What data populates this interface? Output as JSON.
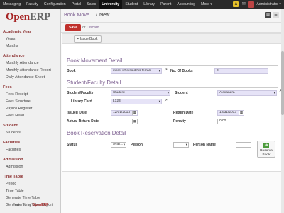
{
  "topbar": {
    "menu": [
      "Messaging",
      "Faculty",
      "Configuration",
      "Portal",
      "Sales",
      "University",
      "Student",
      "Library",
      "Parent",
      "Accounting",
      "More ▾"
    ],
    "active_index": 5,
    "badge": "A",
    "user_name": "Administrator ▾"
  },
  "sidebar": {
    "logo_main": "Open",
    "logo_brand": "ERP",
    "groups": [
      {
        "heading": "Academic Year",
        "items": [
          "Years",
          "Months"
        ]
      },
      {
        "heading": "Attendance",
        "items": [
          "Monthly Attendance",
          "Monthly Attendance Report",
          "Daily Attendance Sheet"
        ]
      },
      {
        "heading": "Fees",
        "items": [
          "Fees Receipt",
          "Fees Structure",
          "Payroll Register",
          "Fees Head"
        ]
      },
      {
        "heading": "Student",
        "items": [
          "Students"
        ]
      },
      {
        "heading": "Faculties",
        "items": [
          "Faculties"
        ]
      },
      {
        "heading": "Admission",
        "items": [
          "Admission"
        ]
      },
      {
        "heading": "Time Table",
        "items": [
          "Period",
          "Time Table",
          "Generate Time Table",
          "Generate Time Table Report"
        ]
      }
    ],
    "powered_by": "Powered by",
    "powered_brand": "OpenERP"
  },
  "header": {
    "breadcrumb_parent": "Book Move...",
    "separator": "/",
    "breadcrumb_current": "New"
  },
  "actions": {
    "save_label": "Save",
    "or_text": "or",
    "discard_label": "Discard"
  },
  "form": {
    "issue_button": "Issue Book",
    "book_movement": {
      "title": "Book Movement Detail",
      "book_label": "Book",
      "book_value": "monk who sold his ferrari",
      "num_books_label": "No. Of Books",
      "num_books_value": "0"
    },
    "student_faculty": {
      "title": "Student/Faculty Detail",
      "sf_label": "Student/Faculty",
      "sf_value": "Student",
      "student_label": "Student",
      "student_value": "Alexandra",
      "library_card_label": "Library Card",
      "library_card_value": "L123",
      "issued_date_label": "Issued Date",
      "issued_date_value": "12/01/2013",
      "return_date_label": "Return Date",
      "return_date_value": "12/31/2013",
      "actual_return_label": "Actual Return Date",
      "actual_return_value": "",
      "penalty_label": "Penalty",
      "penalty_value": "0.00"
    },
    "reservation": {
      "title": "Book Reservation Detail",
      "status_label": "Status",
      "status_value": "Avail...",
      "person_label": "Person",
      "person_value": "",
      "person_name_label": "Person Name",
      "person_name_value": "",
      "reserve_label_1": "Reserve",
      "reserve_label_2": "Book"
    }
  }
}
